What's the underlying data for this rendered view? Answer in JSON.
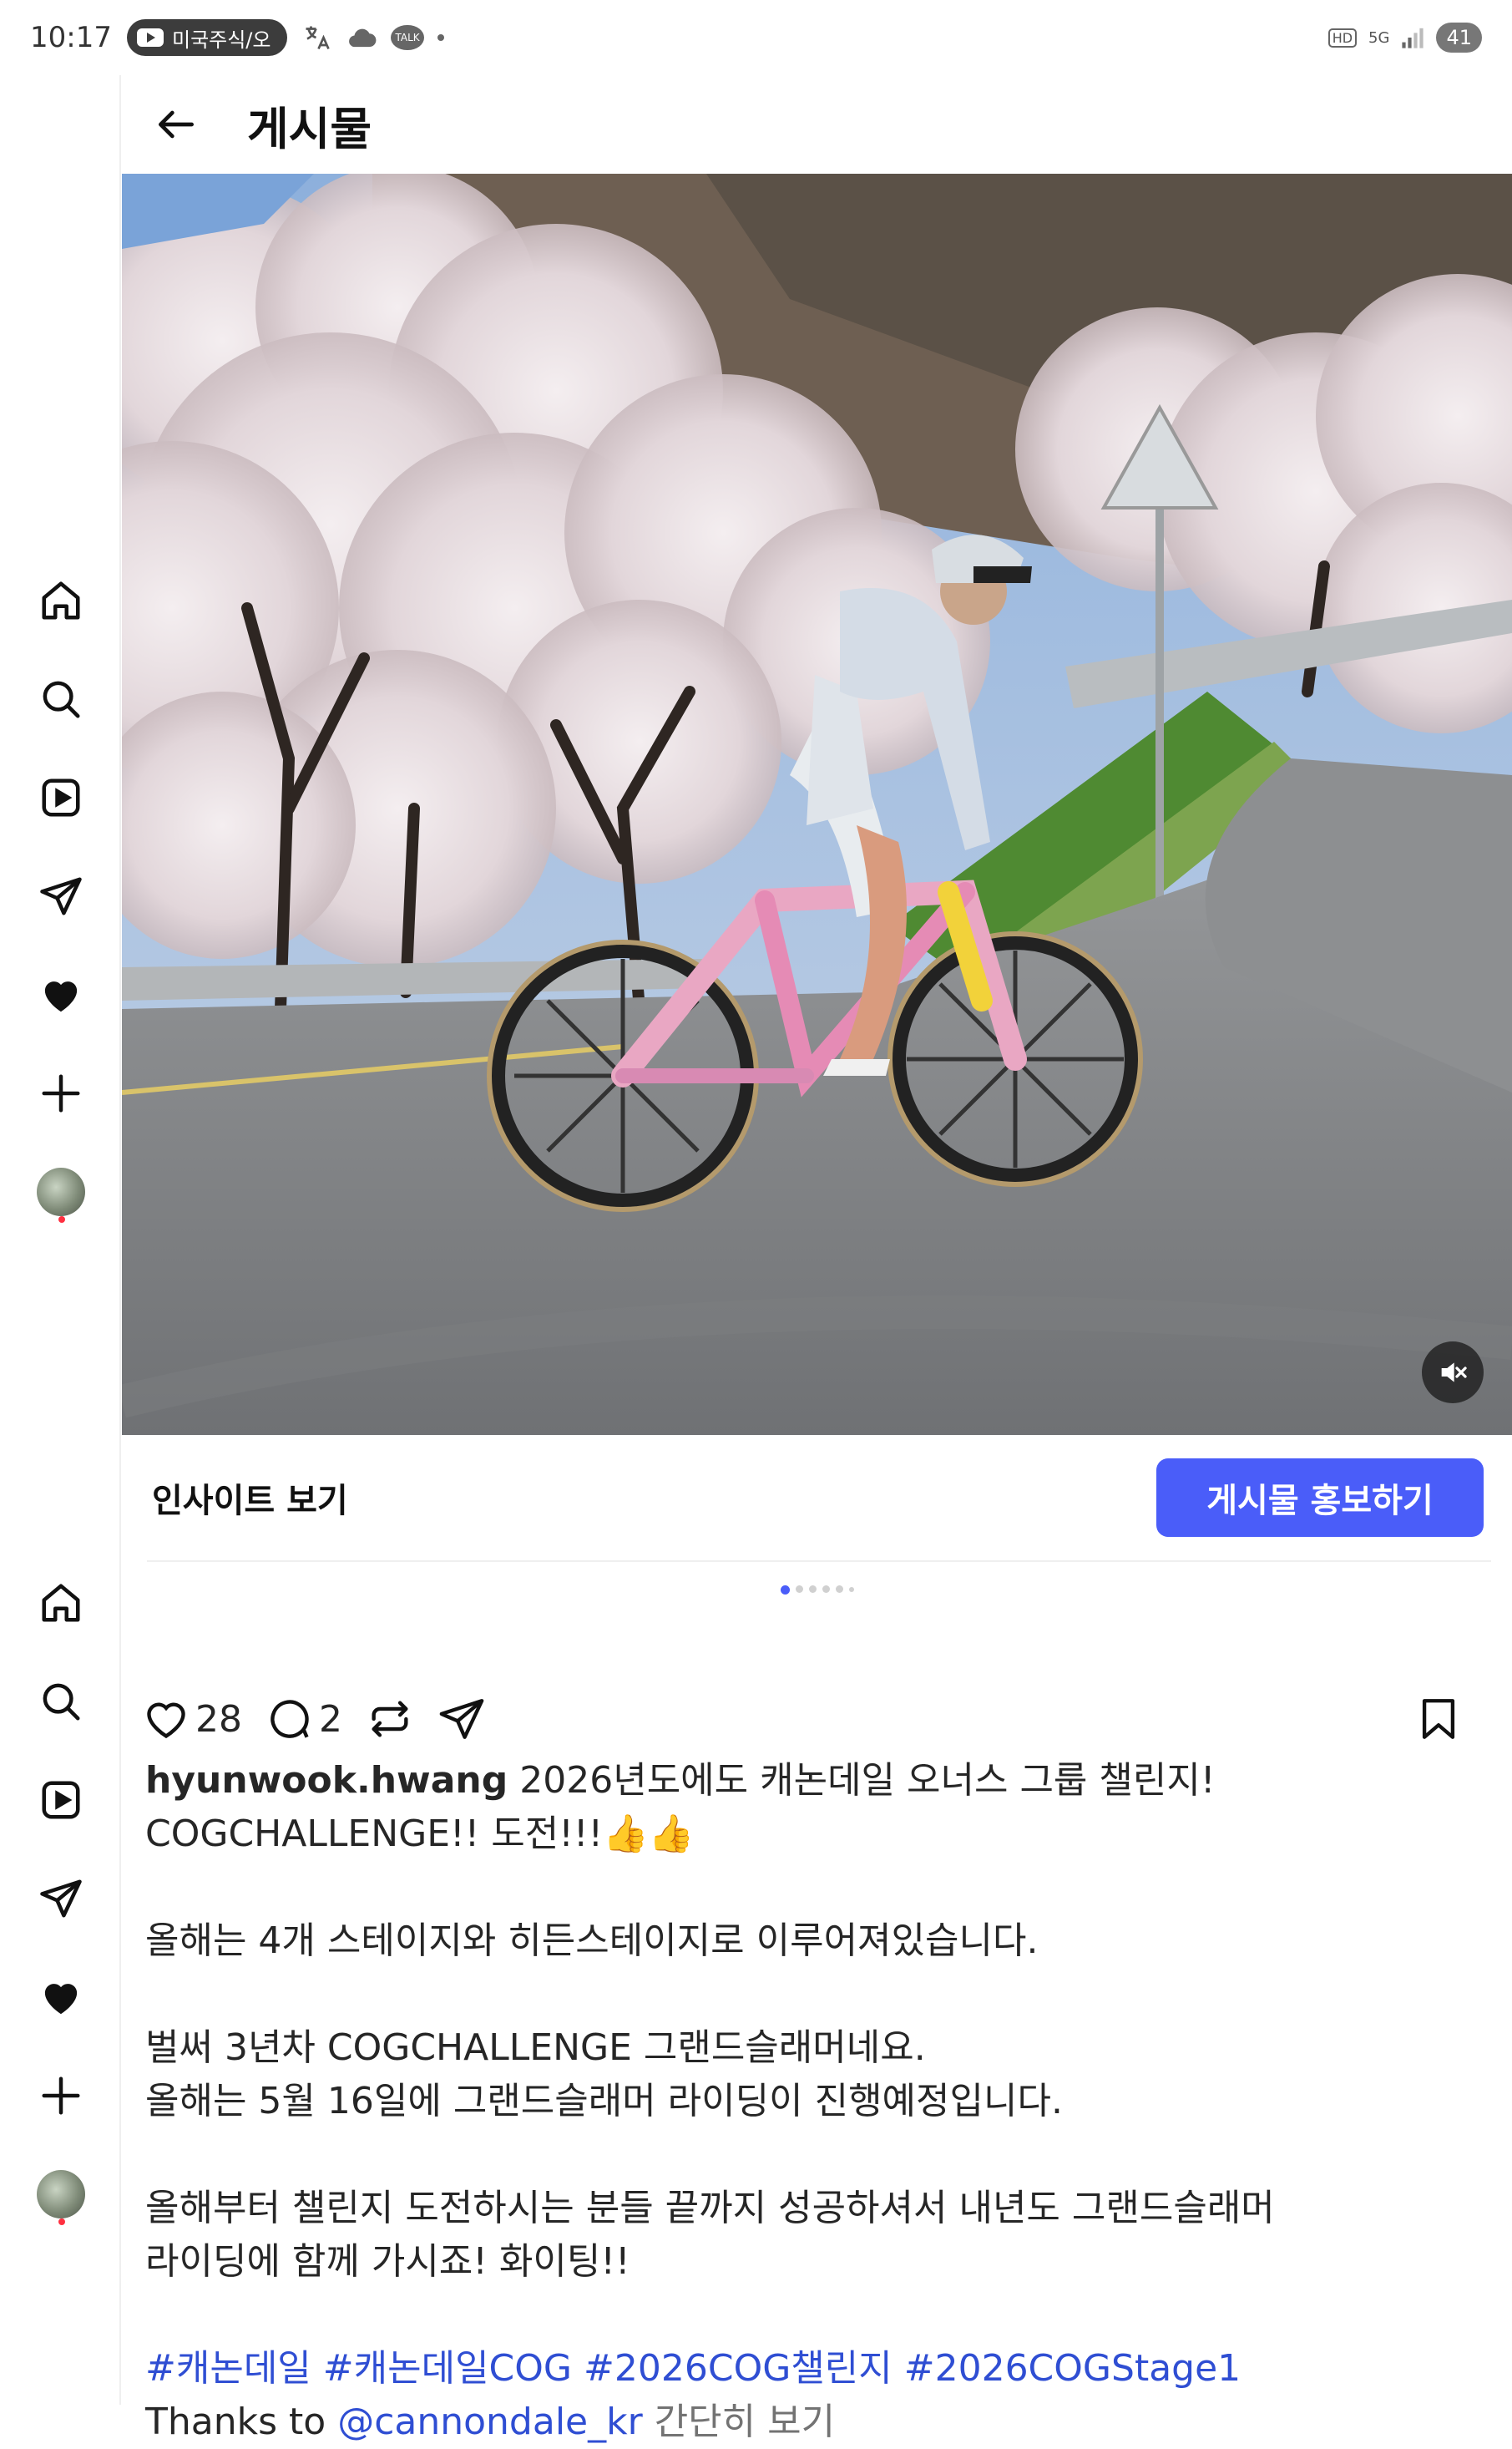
{
  "status_bar": {
    "time": "10:17",
    "notification_text": "미국주식/오",
    "talk_label": "TALK",
    "hd_label": "HD",
    "network": "5G",
    "battery": "41"
  },
  "header": {
    "title": "게시물"
  },
  "post": {
    "insight_label": "인사이트 보기",
    "promote_label": "게시물 홍보하기",
    "likes": "28",
    "comments": "2",
    "username": "hyunwook.hwang",
    "caption_lines": [
      "2026년도에도 캐논데일 오너스 그룹 챌린지!",
      "COGCHALLENGE!! 도전!!!👍👍",
      "",
      "올해는 4개 스테이지와 히든스테이지로 이루어져있습니다.",
      "",
      "벌써 3년차 COGCHALLENGE 그랜드슬래머네요.",
      "올해는 5월 16일에 그랜드슬래머 라이딩이 진행예정입니다.",
      "",
      "올해부터 챌린지 도전하시는 분들 끝까지 성공하셔서 내년도 그랜드슬래머",
      "라이딩에 함께 가시죠! 화이팅!!",
      ""
    ],
    "hashtags": "#캐논데일 #캐논데일COG #2026COG챌린지 #2026COGStage1",
    "thanks_prefix": "Thanks to",
    "mention": "@cannondale_kr",
    "more_label": "간단히 보기"
  },
  "colors": {
    "accent": "#4a5df9",
    "link": "#2f4ed3"
  }
}
